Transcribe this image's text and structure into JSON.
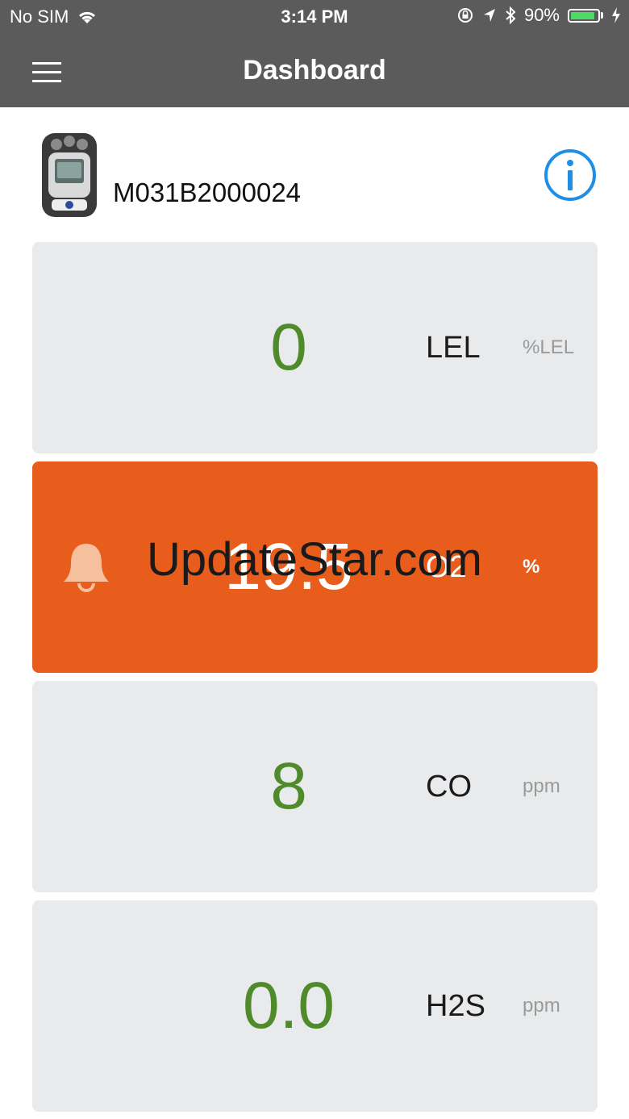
{
  "status_bar": {
    "carrier": "No SIM",
    "time": "3:14 PM",
    "battery": "90%",
    "battery_level": 0.9,
    "icons": [
      "wifi-icon",
      "orientation-lock-icon",
      "location-arrow-icon",
      "bluetooth-icon",
      "battery-icon",
      "charging-bolt-icon"
    ]
  },
  "nav": {
    "title": "Dashboard",
    "menu_icon": "hamburger-menu-icon"
  },
  "device": {
    "id": "M031B2000024",
    "image": "gas-detector-device-image",
    "info_icon": "info-icon"
  },
  "colors": {
    "header_bg": "#5b5b5b",
    "card_bg": "#e9eaeb",
    "alarm_bg": "#e85c1c",
    "value_green": "#4f8b2a",
    "info_blue": "#1f8fe5",
    "battery_green": "#4cd964"
  },
  "readings": [
    {
      "value": "0",
      "gas": "LEL",
      "unit": "%LEL",
      "alarm": false
    },
    {
      "value": "19.5",
      "gas": "O2",
      "unit": "%",
      "alarm": true,
      "alarm_icon": "bell-icon"
    },
    {
      "value": "8",
      "gas": "CO",
      "unit": "ppm",
      "alarm": false
    },
    {
      "value": "0.0",
      "gas": "H2S",
      "unit": "ppm",
      "alarm": false
    }
  ],
  "watermark": "UpdateStar.com"
}
